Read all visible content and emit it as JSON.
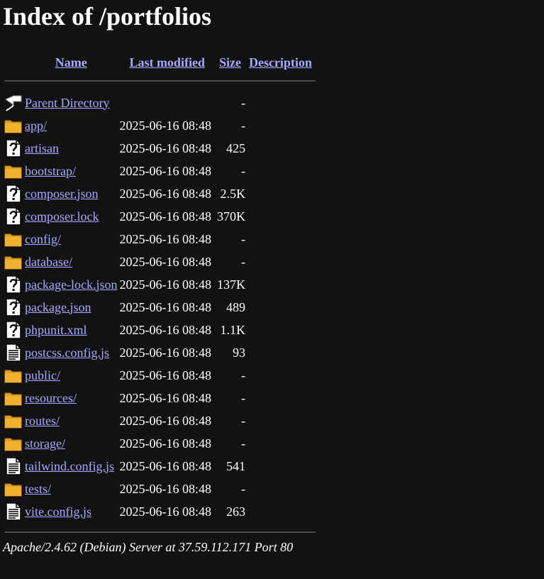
{
  "page": {
    "title": "Index of /portfolios"
  },
  "columns": {
    "name": "Name",
    "last_modified": "Last modified",
    "size": "Size",
    "description": "Description"
  },
  "parent": {
    "name": "Parent Directory",
    "size": "-",
    "icon": "back-arrow-icon"
  },
  "rows": [
    {
      "name": "app/",
      "date": "2025-06-16 08:48",
      "size": "-",
      "icon": "folder-icon"
    },
    {
      "name": "artisan",
      "date": "2025-06-16 08:48",
      "size": "425",
      "icon": "unknown-file-icon"
    },
    {
      "name": "bootstrap/",
      "date": "2025-06-16 08:48",
      "size": "-",
      "icon": "folder-icon"
    },
    {
      "name": "composer.json",
      "date": "2025-06-16 08:48",
      "size": "2.5K",
      "icon": "unknown-file-icon"
    },
    {
      "name": "composer.lock",
      "date": "2025-06-16 08:48",
      "size": "370K",
      "icon": "unknown-file-icon"
    },
    {
      "name": "config/",
      "date": "2025-06-16 08:48",
      "size": "-",
      "icon": "folder-icon"
    },
    {
      "name": "database/",
      "date": "2025-06-16 08:48",
      "size": "-",
      "icon": "folder-icon"
    },
    {
      "name": "package-lock.json",
      "date": "2025-06-16 08:48",
      "size": "137K",
      "icon": "unknown-file-icon"
    },
    {
      "name": "package.json",
      "date": "2025-06-16 08:48",
      "size": "489",
      "icon": "unknown-file-icon"
    },
    {
      "name": "phpunit.xml",
      "date": "2025-06-16 08:48",
      "size": "1.1K",
      "icon": "unknown-file-icon"
    },
    {
      "name": "postcss.config.js",
      "date": "2025-06-16 08:48",
      "size": "93",
      "icon": "text-file-icon"
    },
    {
      "name": "public/",
      "date": "2025-06-16 08:48",
      "size": "-",
      "icon": "folder-icon"
    },
    {
      "name": "resources/",
      "date": "2025-06-16 08:48",
      "size": "-",
      "icon": "folder-icon"
    },
    {
      "name": "routes/",
      "date": "2025-06-16 08:48",
      "size": "-",
      "icon": "folder-icon"
    },
    {
      "name": "storage/",
      "date": "2025-06-16 08:48",
      "size": "-",
      "icon": "folder-icon"
    },
    {
      "name": "tailwind.config.js",
      "date": "2025-06-16 08:48",
      "size": "541",
      "icon": "text-file-icon"
    },
    {
      "name": "tests/",
      "date": "2025-06-16 08:48",
      "size": "-",
      "icon": "folder-icon"
    },
    {
      "name": "vite.config.js",
      "date": "2025-06-16 08:48",
      "size": "263",
      "icon": "text-file-icon"
    }
  ],
  "footer": {
    "address": "Apache/2.4.62 (Debian) Server at 37.59.112.171 Port 80"
  },
  "colors": {
    "background": "#121212",
    "link": "#a8a8ff",
    "folder": "#e0a020",
    "text": "#ffffff"
  }
}
